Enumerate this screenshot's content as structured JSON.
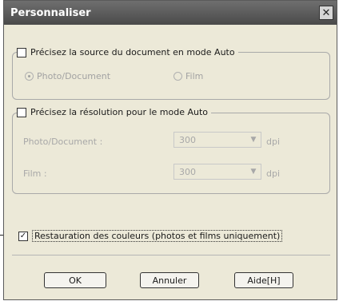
{
  "dialog": {
    "title": "Personnaliser",
    "close_glyph": "✕"
  },
  "source_group": {
    "checkbox_label": "Précisez la source du document en mode Auto",
    "checked": false,
    "radios": [
      {
        "label": "Photo/Document",
        "selected": true
      },
      {
        "label": "Film",
        "selected": false
      }
    ]
  },
  "resolution_group": {
    "checkbox_label": "Précisez la résolution pour le mode Auto",
    "checked": false,
    "rows": [
      {
        "label": "Photo/Document :",
        "value": "300",
        "unit": "dpi"
      },
      {
        "label": "Film :",
        "value": "300",
        "unit": "dpi"
      }
    ]
  },
  "color_restore": {
    "checkbox_label": "Restauration des couleurs (photos et films uniquement)",
    "checked": true,
    "check_glyph": "✓"
  },
  "buttons": {
    "ok": "OK",
    "cancel": "Annuler",
    "help": "Aide[H]"
  }
}
